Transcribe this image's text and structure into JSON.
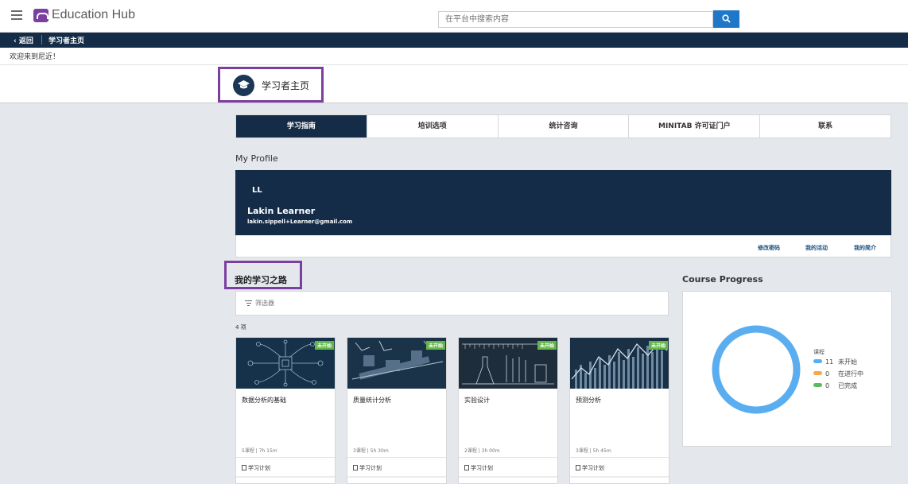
{
  "header": {
    "brand": "Education Hub",
    "search_placeholder": "在平台中搜索内容"
  },
  "breadcrumb": {
    "back_label": "返回",
    "current": "学习者主页"
  },
  "welcome": "欢迎来到尼近！",
  "page_title": "学习者主页",
  "tabs": [
    {
      "label": "学习指南",
      "active": true
    },
    {
      "label": "培训选项",
      "active": false
    },
    {
      "label": "统计咨询",
      "active": false
    },
    {
      "label": "MINITAB 许可证门户",
      "active": false
    },
    {
      "label": "联系",
      "active": false
    }
  ],
  "profile": {
    "section_title": "My Profile",
    "initials": "LL",
    "name": "Lakin Learner",
    "email": "lakin.sippell+Learner@gmail.com",
    "links": {
      "change_password": "修改密码",
      "my_activity": "我的活动",
      "my_bio": "我的简介"
    }
  },
  "learning_path": {
    "title": "我的学习之路",
    "filter_label": "筛选器",
    "count_label": "4 项",
    "courses": [
      {
        "title": "数据分析的基础",
        "meta": "5课程 | 7h 15m",
        "badge": "未开始",
        "plan": "学习计划"
      },
      {
        "title": "质量统计分析",
        "meta": "3课程 | 5h 30m",
        "badge": "未开始",
        "plan": "学习计划"
      },
      {
        "title": "实验设计",
        "meta": "2课程 | 3h 00m",
        "badge": "未开始",
        "plan": "学习计划"
      },
      {
        "title": "预测分析",
        "meta": "3课程 | 5h 45m",
        "badge": "未开始",
        "plan": "学习计划"
      }
    ]
  },
  "course_progress": {
    "title": "Course Progress",
    "legend_title": "课程",
    "items": [
      {
        "count": "11",
        "label": "未开始",
        "color": "#5aaef0"
      },
      {
        "count": "0",
        "label": "在进行中",
        "color": "#f5a843"
      },
      {
        "count": "0",
        "label": "已完成",
        "color": "#5cba5c"
      }
    ]
  },
  "colors": {
    "accent": "#7b3fa0",
    "navy": "#142c47",
    "primary_blue": "#1f78c7",
    "badge_green": "#62b548"
  }
}
